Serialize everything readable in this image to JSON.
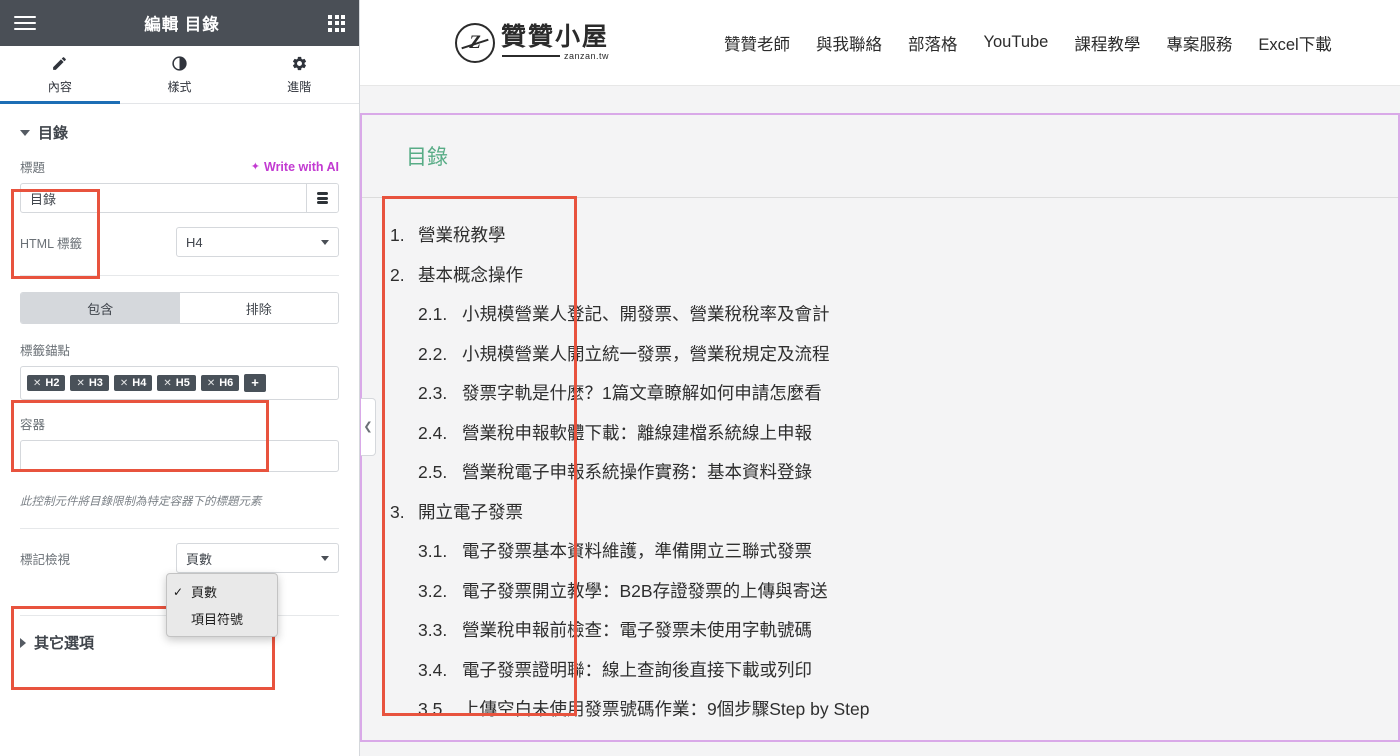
{
  "panel": {
    "title": "編輯 目錄",
    "hamburger_icon": "hamburger-menu-icon",
    "apps_icon": "grid-apps-icon",
    "tabs": [
      {
        "label": "內容",
        "icon": "pencil-icon",
        "active": true
      },
      {
        "label": "樣式",
        "icon": "contrast-half-circle-icon",
        "active": false
      },
      {
        "label": "進階",
        "icon": "gear-icon",
        "active": false
      }
    ],
    "section": {
      "title": "目錄",
      "expanded": true
    },
    "title_field": {
      "label": "標題",
      "ai_label": "Write with AI",
      "ai_color": "#c23ad1",
      "value": "目錄",
      "placeholder": "",
      "dynamic_icon": "dynamic-tags-icon"
    },
    "html_tag": {
      "label": "HTML 標籤",
      "value": "H4"
    },
    "segmented": {
      "options": [
        "包含",
        "排除"
      ],
      "selected": "包含"
    },
    "anchors": {
      "label": "標籤錨點",
      "chips": [
        "H2",
        "H3",
        "H4",
        "H5",
        "H6"
      ],
      "add_label": "+"
    },
    "container": {
      "label": "容器",
      "value": "",
      "placeholder": ""
    },
    "hint": "此控制元件將目錄限制為特定容器下的標題元素",
    "marker_view": {
      "label": "標記檢視",
      "selected": "頁數",
      "options": [
        {
          "label": "頁數",
          "checked": true
        },
        {
          "label": "項目符號",
          "checked": false
        }
      ]
    },
    "other_options": {
      "label": "其它選項",
      "expanded": false
    },
    "collapse_handle_icon": "chevron-left-icon",
    "annotation_color": "#e8533e"
  },
  "site": {
    "logo": {
      "mark": "Z",
      "name": "贊贊小屋",
      "domain": "zanzan.tw"
    },
    "nav": [
      "贊贊老師",
      "與我聯絡",
      "部落格",
      "YouTube",
      "課程教學",
      "專案服務",
      "Excel下載"
    ]
  },
  "toc": {
    "heading": "目錄",
    "heading_color": "#58ac86",
    "selection_border": "#d9a9e8",
    "items": [
      {
        "level": 1,
        "num": "1.",
        "text": "營業稅教學"
      },
      {
        "level": 1,
        "num": "2.",
        "text": "基本概念操作"
      },
      {
        "level": 2,
        "num": "2.1.",
        "text": "小規模營業人登記、開發票、營業稅稅率及會計"
      },
      {
        "level": 2,
        "num": "2.2.",
        "text": "小規模營業人開立統一發票，營業稅規定及流程"
      },
      {
        "level": 2,
        "num": "2.3.",
        "text": "發票字軌是什麼？1篇文章瞭解如何申請怎麼看"
      },
      {
        "level": 2,
        "num": "2.4.",
        "text": "營業稅申報軟體下載：離線建檔系統線上申報"
      },
      {
        "level": 2,
        "num": "2.5.",
        "text": "營業稅電子申報系統操作實務：基本資料登錄"
      },
      {
        "level": 1,
        "num": "3.",
        "text": "開立電子發票"
      },
      {
        "level": 2,
        "num": "3.1.",
        "text": "電子發票基本資料維護，準備開立三聯式發票"
      },
      {
        "level": 2,
        "num": "3.2.",
        "text": "電子發票開立教學：B2B存證發票的上傳與寄送"
      },
      {
        "level": 2,
        "num": "3.3.",
        "text": "營業稅申報前檢查：電子發票未使用字軌號碼"
      },
      {
        "level": 2,
        "num": "3.4.",
        "text": "電子發票證明聯：線上查詢後直接下載或列印"
      },
      {
        "level": 2,
        "num": "3.5.",
        "text": "上傳空白未使用發票號碼作業：9個步驟Step by Step"
      }
    ]
  }
}
